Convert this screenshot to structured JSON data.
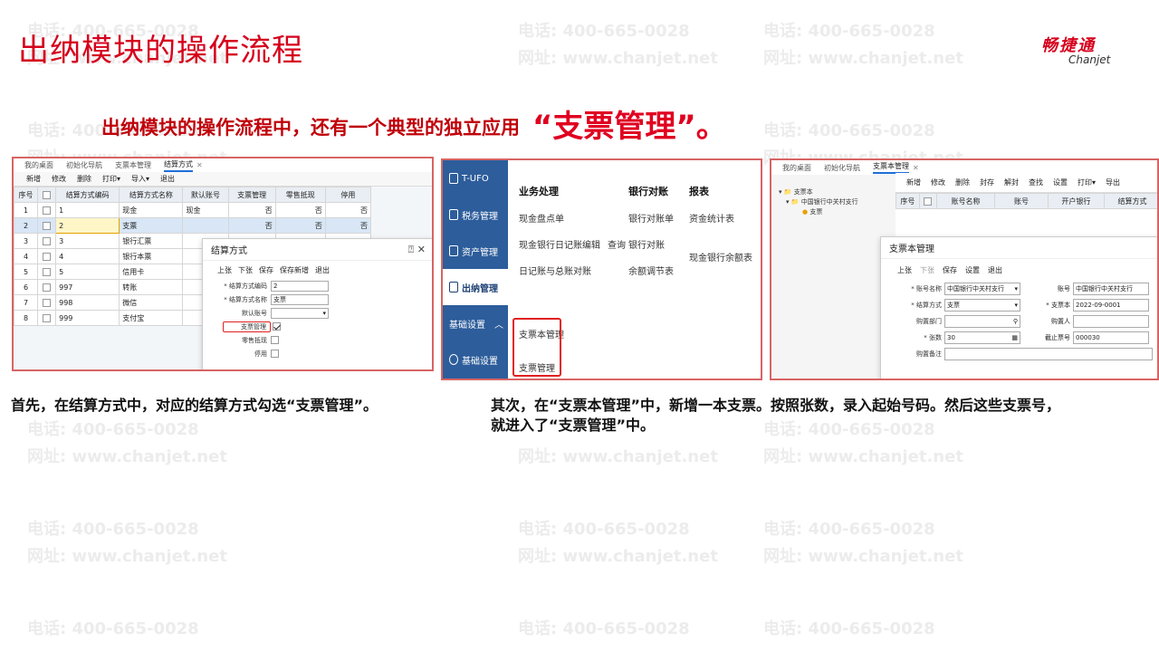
{
  "title": "出纳模块的操作流程",
  "logo": {
    "cn": "畅捷通",
    "en": "Chanjet"
  },
  "watermark": {
    "phone": "电话: 400-665-0028",
    "site": "网址: www.chanjet.net"
  },
  "subtitle": {
    "text": "出纳模块的操作流程中，还有一个典型的独立应用",
    "highlight": "“支票管理”。"
  },
  "panel1": {
    "tabs": [
      "我的桌面",
      "初始化导航",
      "支票本管理",
      "结算方式"
    ],
    "toolbar": [
      "新增",
      "修改",
      "删除",
      "打印▾",
      "导入▾",
      "退出"
    ],
    "columns": [
      "序号",
      "",
      "结算方式编码",
      "结算方式名称",
      "默认账号",
      "支票管理",
      "零售抵现",
      "停用"
    ],
    "rows": [
      [
        "1",
        "1",
        "现金",
        "现金",
        "否",
        "否",
        "否"
      ],
      [
        "2",
        "2",
        "支票",
        "",
        "否",
        "否",
        "否"
      ],
      [
        "3",
        "3",
        "银行汇票",
        "",
        "",
        "",
        ""
      ],
      [
        "4",
        "4",
        "银行本票",
        "",
        "",
        "",
        ""
      ],
      [
        "5",
        "5",
        "信用卡",
        "",
        "",
        "",
        ""
      ],
      [
        "6",
        "997",
        "转账",
        "",
        "",
        "",
        ""
      ],
      [
        "7",
        "998",
        "微信",
        "",
        "",
        "",
        ""
      ],
      [
        "8",
        "999",
        "支付宝",
        "",
        "",
        "",
        ""
      ]
    ],
    "dialog": {
      "title": "结算方式",
      "toolbar": [
        "上张",
        "下张",
        "保存",
        "保存新增",
        "退出"
      ],
      "code_label": "* 结算方式编码",
      "code_value": "2",
      "name_label": "* 结算方式名称",
      "name_value": "支票",
      "account_label": "默认账号",
      "check_label": "支票管理",
      "cash_label": "零售抵现",
      "stop_label": "停用"
    }
  },
  "panel2": {
    "nav": [
      "T-UFO",
      "税务管理",
      "资产管理",
      "出纳管理",
      "基础设置",
      "基础设置"
    ],
    "col1": {
      "header": "业务处理",
      "items": [
        "现金盘点单",
        "现金银行日记账编辑",
        "日记账与总账对账"
      ],
      "extra": "查询"
    },
    "col2": {
      "header": "银行对账",
      "items": [
        "银行对账单",
        "银行对账",
        "余额调节表"
      ]
    },
    "col3": {
      "header": "报表",
      "items": [
        "资金统计表",
        "现金银行余额表"
      ]
    },
    "boxed": [
      "支票本管理",
      "支票管理"
    ]
  },
  "panel3": {
    "tabs": [
      "我的桌面",
      "初始化导航",
      "支票本管理"
    ],
    "tree": [
      "支票本",
      "中国银行中关村支行",
      "支票"
    ],
    "toolbar": [
      "新增",
      "修改",
      "删除",
      "封存",
      "解封",
      "查找",
      "设置",
      "打印▾",
      "导出"
    ],
    "columns": [
      "序号",
      "",
      "账号名称",
      "账号",
      "开户银行",
      "结算方式"
    ],
    "dialog": {
      "title": "支票本管理",
      "toolbar": [
        "上张",
        "下张",
        "保存",
        "设置",
        "退出"
      ],
      "acct_name_label": "* 账号名称",
      "acct_name_value": "中国银行中关村支行",
      "acct_label": "账号",
      "acct_value": "中国银行中关村支行",
      "settle_label": "* 结算方式",
      "settle_value": "支票",
      "book_label": "* 支票本",
      "book_value": "2022-09-0001",
      "dept_label": "购置部门",
      "buyer_label": "购置人",
      "count_label": "* 张数",
      "count_value": "30",
      "end_label": "截止票号",
      "end_value": "000030",
      "note_label": "购置备注"
    }
  },
  "caption1": "首先，在结算方式中，对应的结算方式勾选“支票管理”。",
  "caption2a": "其次，在“支票本管理”中，新增一本支票。按照张数，录入起始号码。然后这些支票号，",
  "caption2b": "就进入了“支票管理”中。"
}
